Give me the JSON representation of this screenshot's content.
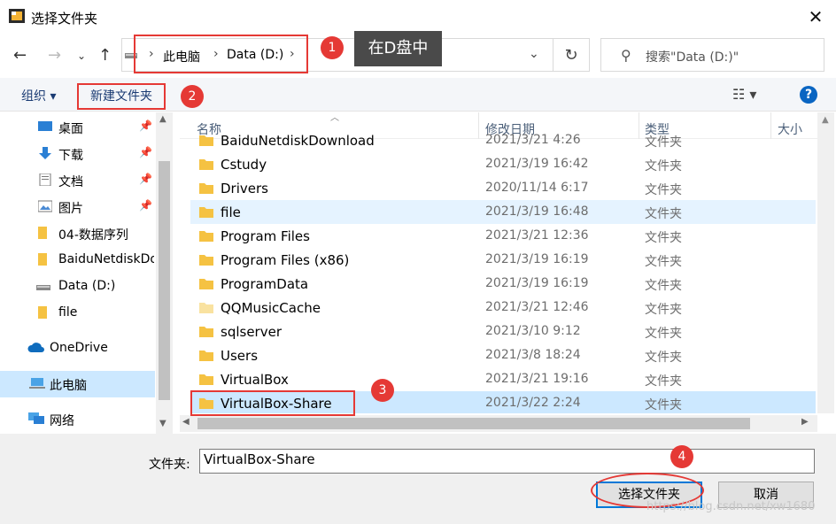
{
  "window": {
    "title": "选择文件夹"
  },
  "address": {
    "crumbs": [
      "此电脑",
      "Data (D:)"
    ]
  },
  "search": {
    "placeholder": "搜索\"Data (D:)\""
  },
  "toolbar": {
    "organize": "组织 ▾",
    "new_folder": "新建文件夹"
  },
  "sidebar": {
    "items": [
      {
        "label": "桌面",
        "icon": "desktop-icon",
        "pinned": true
      },
      {
        "label": "下载",
        "icon": "download-icon",
        "pinned": true
      },
      {
        "label": "文档",
        "icon": "document-icon",
        "pinned": true
      },
      {
        "label": "图片",
        "icon": "picture-icon",
        "pinned": true
      },
      {
        "label": "04-数据序列",
        "icon": "folder-icon"
      },
      {
        "label": "BaiduNetdiskDo",
        "icon": "folder-icon"
      },
      {
        "label": "Data (D:)",
        "icon": "drive-icon"
      },
      {
        "label": "file",
        "icon": "folder-icon"
      },
      {
        "label": "OneDrive",
        "icon": "cloud-icon"
      },
      {
        "label": "此电脑",
        "icon": "computer-icon"
      },
      {
        "label": "网络",
        "icon": "network-icon"
      }
    ]
  },
  "columns": {
    "name": "名称",
    "date": "修改日期",
    "type": "类型",
    "size": "大小"
  },
  "files": [
    {
      "name": "BaiduNetdiskDownload",
      "date": "2021/3/21 4:26",
      "type": "文件夹"
    },
    {
      "name": "Cstudy",
      "date": "2021/3/19 16:42",
      "type": "文件夹"
    },
    {
      "name": "Drivers",
      "date": "2020/11/14 6:17",
      "type": "文件夹"
    },
    {
      "name": "file",
      "date": "2021/3/19 16:48",
      "type": "文件夹"
    },
    {
      "name": "Program Files",
      "date": "2021/3/21 12:36",
      "type": "文件夹"
    },
    {
      "name": "Program Files (x86)",
      "date": "2021/3/19 16:19",
      "type": "文件夹"
    },
    {
      "name": "ProgramData",
      "date": "2021/3/19 16:19",
      "type": "文件夹"
    },
    {
      "name": "QQMusicCache",
      "date": "2021/3/21 12:46",
      "type": "文件夹"
    },
    {
      "name": "sqlserver",
      "date": "2021/3/10 9:12",
      "type": "文件夹"
    },
    {
      "name": "Users",
      "date": "2021/3/8 18:24",
      "type": "文件夹"
    },
    {
      "name": "VirtualBox",
      "date": "2021/3/21 19:16",
      "type": "文件夹"
    },
    {
      "name": "VirtualBox-Share",
      "date": "2021/3/22 2:24",
      "type": "文件夹"
    }
  ],
  "bottom": {
    "folder_label": "文件夹:",
    "folder_value": "VirtualBox-Share",
    "ok": "选择文件夹",
    "cancel": "取消"
  },
  "annotations": {
    "badges": [
      "1",
      "2",
      "3",
      "4"
    ],
    "callout": "在D盘中"
  },
  "watermark": "https://blog.csdn.net/xw1680",
  "colors": {
    "accent": "#0078d7",
    "selected_row": "#cce8ff",
    "annotation_red": "#e53935"
  }
}
